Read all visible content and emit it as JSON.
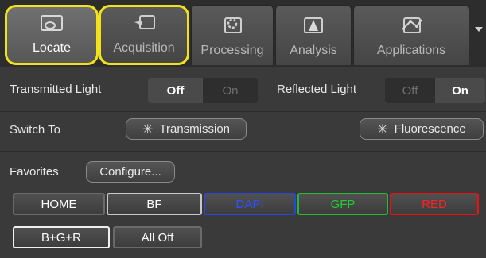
{
  "tabs": [
    {
      "label": "Locate",
      "icon": "microscope-icon",
      "active": true
    },
    {
      "label": "Acquisition",
      "icon": "camera-icon",
      "active": false
    },
    {
      "label": "Processing",
      "icon": "gear-icon",
      "active": false
    },
    {
      "label": "Analysis",
      "icon": "cone-icon",
      "active": false
    },
    {
      "label": "Applications",
      "icon": "network-icon",
      "active": false
    }
  ],
  "light": {
    "transmitted_label": "Transmitted Light",
    "transmitted_off": "Off",
    "transmitted_on": "On",
    "transmitted_state": "Off",
    "reflected_label": "Reflected Light",
    "reflected_off": "Off",
    "reflected_on": "On",
    "reflected_state": "On"
  },
  "switch_to": {
    "label": "Switch To",
    "transmission": "Transmission",
    "fluorescence": "Fluorescence"
  },
  "favorites": {
    "label": "Favorites",
    "configure": "Configure...",
    "buttons": [
      {
        "label": "HOME",
        "color": "#ffffff",
        "border": "#6a6a6a"
      },
      {
        "label": "BF",
        "color": "#ffffff",
        "border": "#c8c8c8"
      },
      {
        "label": "DAPI",
        "color": "#3050ff",
        "border": "#2a45e0"
      },
      {
        "label": "GFP",
        "color": "#22cc33",
        "border": "#22bb33"
      },
      {
        "label": "RED",
        "color": "#ff2020",
        "border": "#ee1111"
      },
      {
        "label": "B+G+R",
        "color": "#ffffff",
        "border": "#f0f0f0"
      },
      {
        "label": "All Off",
        "color": "#ffffff",
        "border": "#6a6a6a"
      }
    ]
  },
  "colors": {
    "highlight": "#f2e21a",
    "panel": "#3a3a3a"
  }
}
